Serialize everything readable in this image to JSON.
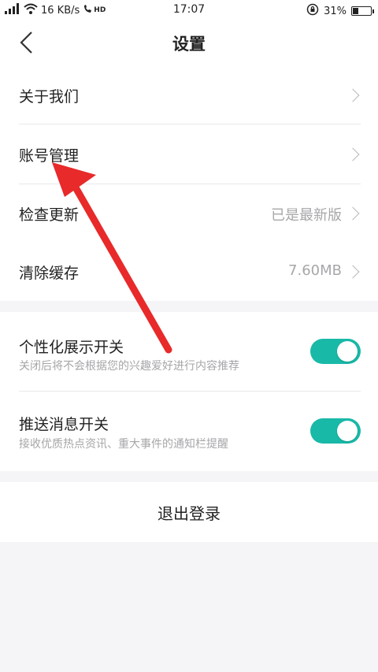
{
  "status_bar": {
    "network": "16 KB/s",
    "hd": "HD",
    "time": "17:07",
    "battery": "31%",
    "battery_level": 0.31
  },
  "nav": {
    "title": "设置"
  },
  "menu": {
    "about": {
      "label": "关于我们"
    },
    "account": {
      "label": "账号管理"
    },
    "update": {
      "label": "检查更新",
      "value": "已是最新版"
    },
    "cache": {
      "label": "清除缓存",
      "value": "7.60MB"
    }
  },
  "toggles": {
    "personalized": {
      "title": "个性化展示开关",
      "subtitle": "关闭后将不会根据您的兴趣爱好进行内容推荐",
      "on": true
    },
    "push": {
      "title": "推送消息开关",
      "subtitle": "接收优质热点资讯、重大事件的通知栏提醒",
      "on": true
    }
  },
  "logout": {
    "label": "退出登录"
  },
  "colors": {
    "accent": "#19b9a8",
    "annotation": "#e82a2a"
  }
}
